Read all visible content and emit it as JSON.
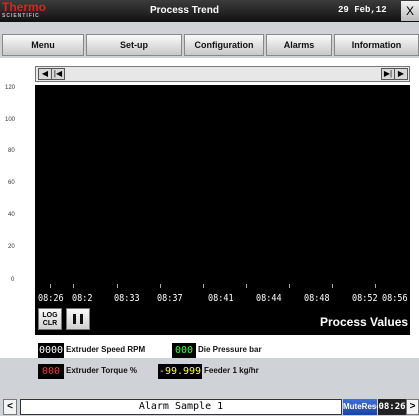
{
  "header": {
    "brand_main": "Thermo",
    "brand_sub": "SCIENTIFIC",
    "title": "Process Trend",
    "date": "29 Feb,12",
    "close_label": "X"
  },
  "menu": {
    "items": [
      "Menu",
      "Set-up",
      "Configuration",
      "Alarms",
      "Information"
    ]
  },
  "chart": {
    "y_ticks": [
      "120",
      "100",
      "80",
      "60",
      "40",
      "20",
      "0"
    ],
    "x_labels": [
      "08:26",
      "08:2",
      "08:33",
      "08:37",
      "08:41",
      "08:44",
      "08:48",
      "08:52",
      "08:56"
    ],
    "log_clr_label": "LOG\nCLR",
    "pause_icon": "pause-icon",
    "process_values_label": "Process Values",
    "scroll_left_labels": [
      "◀",
      "|◀"
    ],
    "scroll_right_labels": [
      "▶|",
      "▶"
    ]
  },
  "legend": [
    {
      "value": "0000",
      "value_color": "#ffffff",
      "label": "Extruder Speed RPM"
    },
    {
      "value": "000",
      "value_color": "#33ff33",
      "label": "Die Pressure bar"
    },
    {
      "value": "000",
      "value_color": "#ff3333",
      "label": "Extruder Torque %"
    },
    {
      "value": "-99.999",
      "value_color": "#ffff33",
      "label": "Feeder 1 kg/hr"
    }
  ],
  "status": {
    "left_arrow": "<",
    "alarm_text": "Alarm Sample 1",
    "mute_reset": "MuteReset",
    "time": "08:26",
    "right_arrow": ">"
  },
  "colors": {
    "accent": "#1a42a8",
    "brand": "#e02020",
    "plot_background": "#000000"
  }
}
